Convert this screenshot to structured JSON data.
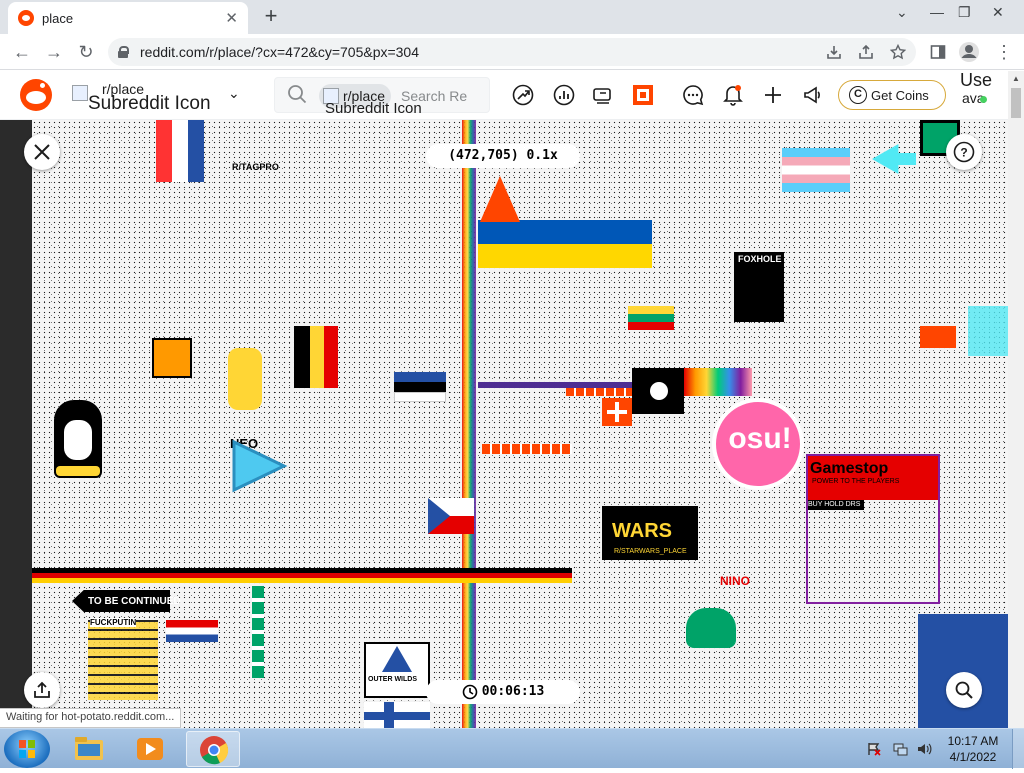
{
  "browser": {
    "tab_title": "place",
    "new_tab": "+",
    "url": "reddit.com/r/place/?cx=472&cy=705&px=304",
    "win_min": "—",
    "win_restore": "❐",
    "win_close": "✕",
    "win_down": "⌄"
  },
  "reddit_header": {
    "community_label": "r/place",
    "community_icon_alt": "Subreddit Icon",
    "search_pill": "r/place",
    "search_pill_alt": "Subreddit Icon",
    "search_placeholder": "Search Re",
    "get_coins": "Get Coins",
    "user_alt": "Use",
    "user_alt2": "ava",
    "icons": [
      "popular-icon",
      "chart-icon",
      "communities-icon",
      "rpan-icon",
      "chat-icon",
      "notifications-icon",
      "create-post-icon",
      "advertise-icon"
    ]
  },
  "canvas": {
    "coordinates": "(472,705) 0.1x",
    "timer": "00:06:13",
    "art_labels": {
      "tagpro": "R/TAGPRO",
      "foxhole": "FOXHOLE",
      "neo": "NEO",
      "osu": "osu!",
      "gamestop": "Gamestop",
      "gamestop_sub": "POWER TO THE PLAYERS",
      "hodl": "BUY HOLD DRS",
      "wars": "WARS",
      "starwars": "R/STARWARS_PLACE",
      "tobecontinued": "TO BE CONTINUED",
      "fuckputin": "FUCKPUTIN",
      "outerwilds": "OUTER WILDS",
      "ninety": "NINO"
    }
  },
  "status_bar": "Waiting for hot-potato.reddit.com...",
  "taskbar": {
    "time": "10:17 AM",
    "date": "4/1/2022"
  },
  "colors": {
    "reddit_orange": "#ff4500",
    "ukraine_blue": "#0057b7",
    "ukraine_yellow": "#ffd700",
    "coins_border": "#d7a93b",
    "taskbar": "#9dbcdf"
  }
}
